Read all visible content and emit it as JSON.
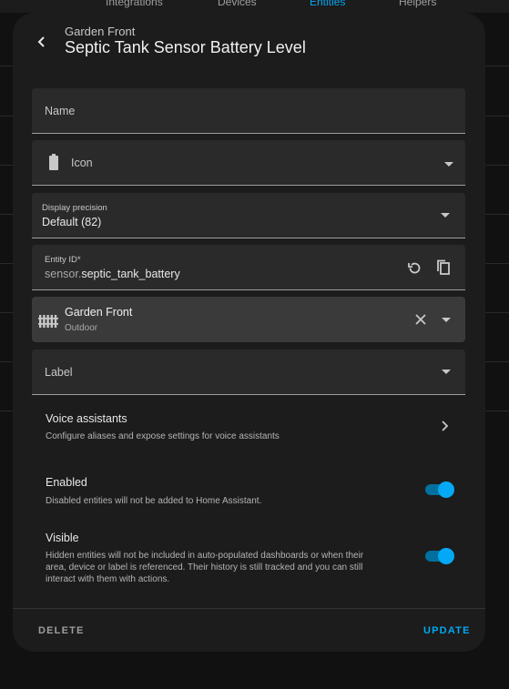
{
  "background_tabs": [
    "Integrations",
    "Devices",
    "Entities",
    "Helpers"
  ],
  "header": {
    "subtitle": "Garden Front",
    "title": "Septic Tank Sensor Battery Level"
  },
  "fields": {
    "name_label": "Name",
    "icon_label": "Icon",
    "precision_label": "Display precision",
    "precision_value": "Default (82)",
    "entity_id_label": "Entity ID*",
    "entity_id_prefix": "sensor.",
    "entity_id_value": "septic_tank_battery",
    "area_name": "Garden Front",
    "area_floor": "Outdoor",
    "label_label": "Label"
  },
  "voice": {
    "title": "Voice assistants",
    "subtitle": "Configure aliases and expose settings for voice assistants"
  },
  "enabled": {
    "title": "Enabled",
    "subtitle": "Disabled entities will not be added to Home Assistant.",
    "on": true
  },
  "visible": {
    "title": "Visible",
    "subtitle_l1": "Hidden entities will not be included in auto-populated dashboards or when their",
    "subtitle_l2": "area, device or label is referenced. Their history is still tracked and you can still",
    "subtitle_l3": "interact with them with actions.",
    "on": true
  },
  "footer": {
    "delete_label": "DELETE",
    "update_label": "UPDATE"
  },
  "colors": {
    "accent": "#03a9f4",
    "delete": "#9e9e9e"
  },
  "icons": [
    "back-arrow-icon",
    "battery-icon",
    "refresh-icon",
    "copy-icon",
    "fence-icon",
    "close-icon",
    "chevron-right-icon"
  ]
}
